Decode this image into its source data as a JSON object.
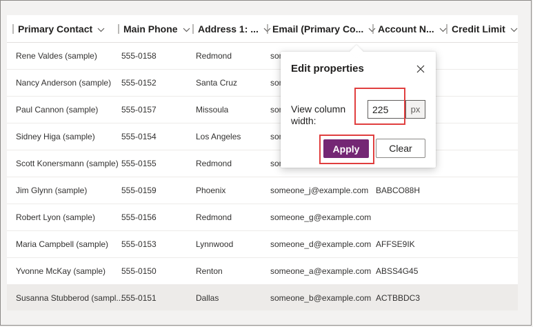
{
  "columns": [
    {
      "label": "Primary Contact"
    },
    {
      "label": "Main Phone"
    },
    {
      "label": "Address 1: ..."
    },
    {
      "label": "Email (Primary Co..."
    },
    {
      "label": "Account N..."
    },
    {
      "label": "Credit Limit"
    }
  ],
  "rows": [
    {
      "contact": "Rene Valdes (sample)",
      "phone": "555-0158",
      "city": "Redmond",
      "email": "som",
      "account": "",
      "credit": ""
    },
    {
      "contact": "Nancy Anderson (sample)",
      "phone": "555-0152",
      "city": "Santa Cruz",
      "email": "som",
      "account": "",
      "credit": ""
    },
    {
      "contact": "Paul Cannon (sample)",
      "phone": "555-0157",
      "city": "Missoula",
      "email": "som",
      "account": "",
      "credit": ""
    },
    {
      "contact": "Sidney Higa (sample)",
      "phone": "555-0154",
      "city": "Los Angeles",
      "email": "som",
      "account": "",
      "credit": ""
    },
    {
      "contact": "Scott Konersmann (sample)",
      "phone": "555-0155",
      "city": "Redmond",
      "email": "som",
      "account": "",
      "credit": ""
    },
    {
      "contact": "Jim Glynn (sample)",
      "phone": "555-0159",
      "city": "Phoenix",
      "email": "someone_j@example.com",
      "account": "BABCO88H",
      "credit": ""
    },
    {
      "contact": "Robert Lyon (sample)",
      "phone": "555-0156",
      "city": "Redmond",
      "email": "someone_g@example.com",
      "account": "",
      "credit": ""
    },
    {
      "contact": "Maria Campbell (sample)",
      "phone": "555-0153",
      "city": "Lynnwood",
      "email": "someone_d@example.com",
      "account": "AFFSE9IK",
      "credit": ""
    },
    {
      "contact": "Yvonne McKay (sample)",
      "phone": "555-0150",
      "city": "Renton",
      "email": "someone_a@example.com",
      "account": "ABSS4G45",
      "credit": ""
    },
    {
      "contact": "Susanna Stubberod (sampl...",
      "phone": "555-0151",
      "city": "Dallas",
      "email": "someone_b@example.com",
      "account": "ACTBBDC3",
      "credit": "",
      "selected": true
    }
  ],
  "popup": {
    "title": "Edit properties",
    "width_label": "View column width:",
    "width_value": "225",
    "unit": "px",
    "apply_label": "Apply",
    "clear_label": "Clear",
    "close_icon": "close-icon"
  },
  "colors": {
    "accent": "#742774",
    "highlight": "#e03e3e",
    "selected_row": "#edebe9"
  }
}
